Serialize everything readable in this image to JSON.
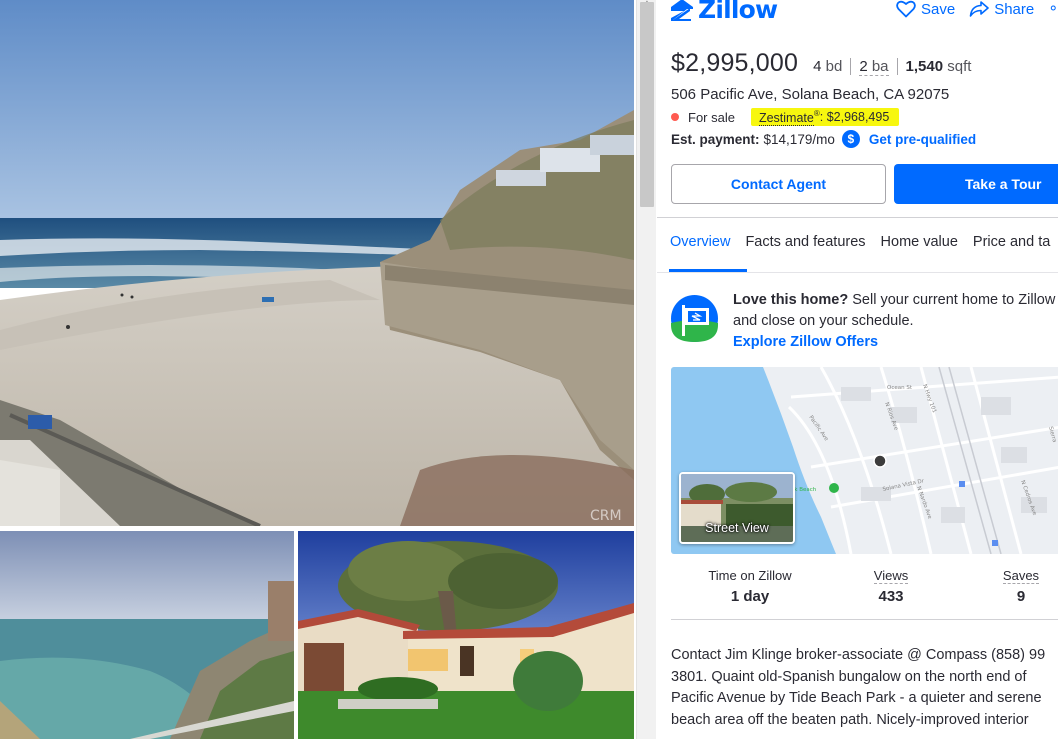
{
  "brand": {
    "name": "Zillow",
    "color": "#006aff"
  },
  "header": {
    "save_label": "Save",
    "share_label": "Share",
    "more_label": "∘∘"
  },
  "listing": {
    "price": "$2,995,000",
    "beds_num": "4",
    "beds_unit": "bd",
    "baths_num": "2",
    "baths_unit": "ba",
    "sqft_num": "1,540",
    "sqft_unit": "sqft",
    "address": "506 Pacific Ave, Solana Beach, CA 92075",
    "status": "For sale",
    "status_color": "#ff5a50",
    "zestimate_label": "Zestimate",
    "zestimate_mark": "®",
    "zestimate_value": ": $2,968,495",
    "payment_label": "Est. payment:",
    "payment_value": "$14,179/mo",
    "payment_icon": "$",
    "prequal_label": "Get pre-qualified"
  },
  "actions": {
    "contact_label": "Contact Agent",
    "tour_label": "Take a Tour"
  },
  "tabs": [
    {
      "label": "Overview",
      "active": true
    },
    {
      "label": "Facts and features",
      "active": false
    },
    {
      "label": "Home value",
      "active": false
    },
    {
      "label": "Price and ta",
      "active": false
    }
  ],
  "offer": {
    "bold": "Love this home?",
    "text": " Sell your current home to Zillow",
    "text2": "and close on your schedule.",
    "link": "Explore Zillow Offers"
  },
  "map": {
    "street_view_label": "Street View",
    "streets": [
      "Ocean St",
      "N Hwy 101",
      "N Rios Ave",
      "Pacific Ave",
      "Solana Vista Dr",
      "N Nardo Ave",
      "N Cedros Ave",
      "Sierra",
      "rk Beach"
    ]
  },
  "stats": [
    {
      "label": "Time on Zillow",
      "value": "1 day"
    },
    {
      "label": "Views",
      "value": "433"
    },
    {
      "label": "Saves",
      "value": "9"
    }
  ],
  "description": [
    "Contact Jim Klinge broker-associate @ Compass (858) 99",
    "3801. Quaint old-Spanish bungalow on the north end of",
    "Pacific Avenue by Tide Beach Park - a quieter and serene",
    "beach area off the beaten path. Nicely-improved interior"
  ],
  "photos": {
    "watermark": "CRM"
  }
}
